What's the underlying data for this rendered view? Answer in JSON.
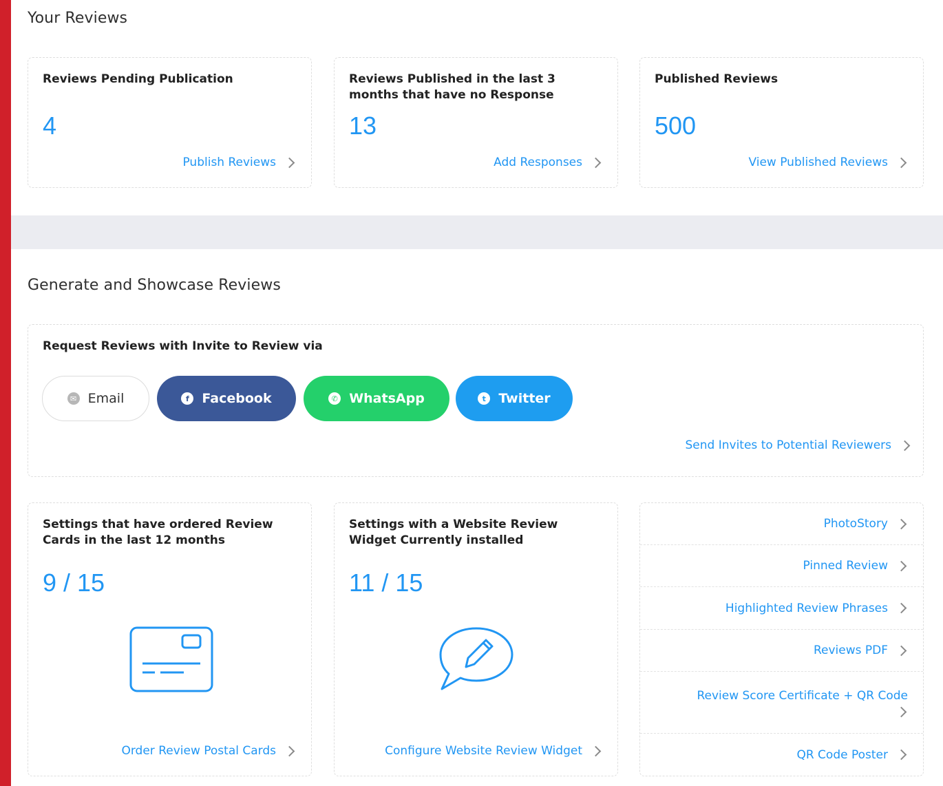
{
  "your_reviews": {
    "title": "Your Reviews",
    "cards": [
      {
        "title": "Reviews Pending Publication",
        "value": "4",
        "link": "Publish Reviews"
      },
      {
        "title": "Reviews Published in the last 3 months that have no Response",
        "value": "13",
        "link": "Add Responses"
      },
      {
        "title": "Published Reviews",
        "value": "500",
        "link": "View Published Reviews"
      }
    ]
  },
  "generate": {
    "title": "Generate and Showcase Reviews",
    "invite": {
      "title": "Request Reviews with Invite to Review via",
      "buttons": [
        {
          "label": "Email",
          "icon": "mail-icon"
        },
        {
          "label": "Facebook",
          "icon": "facebook-icon"
        },
        {
          "label": "WhatsApp",
          "icon": "whatsapp-icon"
        },
        {
          "label": "Twitter",
          "icon": "twitter-icon"
        }
      ],
      "link": "Send Invites to Potential Reviewers"
    },
    "postal_cards": {
      "title": "Settings that have ordered Review Cards in the last 12 months",
      "value": "9 / 15",
      "link": "Order Review Postal Cards",
      "icon": "postal-card-icon"
    },
    "widget": {
      "title": "Settings with a Website Review Widget Currently installed",
      "value": "11 / 15",
      "link": "Configure Website Review Widget",
      "icon": "speech-bubble-pencil-icon"
    },
    "links": [
      "PhotoStory",
      "Pinned Review",
      "Highlighted Review Phrases",
      "Reviews PDF",
      "Review Score Certificate + QR Code",
      "QR Code Poster"
    ]
  },
  "colors": {
    "accent": "#2196f3",
    "frame": "#d0202a",
    "facebook": "#3b5898",
    "whatsapp": "#24d06b",
    "twitter": "#1e9df0"
  }
}
